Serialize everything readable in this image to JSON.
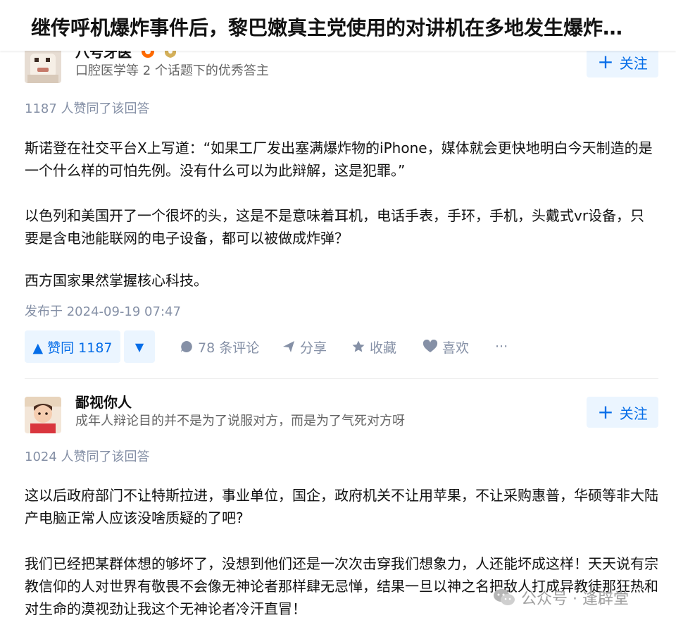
{
  "header": {
    "title": "继传呼机爆炸事件后，黎巴嫩真主党使用的对讲机在多地发生爆炸…"
  },
  "answers": [
    {
      "author_name": "八号牙医",
      "author_bio": "口腔医学等 2 个话题下的优秀答主",
      "follow_label": "关注",
      "votes_text": "1187 人赞同了该回答",
      "paragraphs": [
        "斯诺登在社交平台X上写道：“如果工厂发出塞满爆炸物的iPhone，媒体就会更快地明白今天制造的是一个什么样的可怕先例。没有什么可以为此辩解，这是犯罪。”",
        "以色列和美国开了一个很坏的头，这是不是意味着耳机，电话手表，手环，手机，头戴式vr设备，只要是含电池能联网的电子设备，都可以被做成炸弹？",
        "西方国家果然掌握核心科技。"
      ],
      "published": "发布于 2024-09-19 07:47",
      "actions": {
        "upvote": "▲ 赞同 1187",
        "downvote": "▼",
        "comments": "78 条评论",
        "share": "分享",
        "collect": "收藏",
        "like": "喜欢",
        "more": "···"
      }
    },
    {
      "author_name": "鄙视你人",
      "author_bio": "成年人辩论目的并不是为了说服对方，而是为了气死对方呀",
      "follow_label": "关注",
      "votes_text": "1024 人赞同了该回答",
      "paragraphs": [
        "这以后政府部门不让特斯拉进，事业单位，国企，政府机关不让用苹果，不让采购惠普，华硕等非大陆产电脑正常人应该没啥质疑的了吧?",
        "我们已经把某群体想的够坏了，没想到他们还是一次次击穿我们想象力，人还能坏成这样！天天说有宗教信仰的人对世界有敬畏不会像无神论者那样肆无忌惮，结果一旦以神之名把敌人打成异教徒那狂热和对生命的漠视劲让我这个无神论者冷汗直冒！"
      ]
    }
  ],
  "watermark": {
    "text": "公众号 · 逢辟堂"
  },
  "colors": {
    "accent": "#056de8",
    "accent_bg": "#ebf5ff",
    "meta": "#8590a6",
    "badge": "#ff6a00"
  }
}
